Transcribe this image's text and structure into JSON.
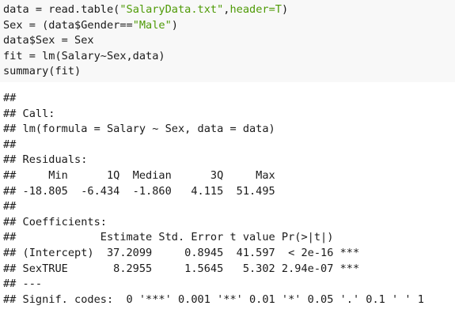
{
  "code": {
    "l1": {
      "a": "data = read.table(",
      "b": "\"SalaryData.txt\"",
      "c": ",",
      "d": "header=T",
      "e": ")"
    },
    "l2": {
      "a": "Sex = (data$Gender==",
      "b": "\"Male\"",
      "c": ")"
    },
    "l3": "data$Sex = Sex",
    "l4": "fit = lm(Salary~Sex,data)",
    "l5": "summary(fit)"
  },
  "output": [
    "##",
    "## Call:",
    "## lm(formula = Salary ~ Sex, data = data)",
    "##",
    "## Residuals:",
    "##     Min      1Q  Median      3Q     Max",
    "## -18.805  -6.434  -1.860   4.115  51.495",
    "##",
    "## Coefficients:",
    "##             Estimate Std. Error t value Pr(>|t|)",
    "## (Intercept)  37.2099     0.8945  41.597  < 2e-16 ***",
    "## SexTRUE       8.2955     1.5645   5.302 2.94e-07 ***",
    "## ---",
    "## Signif. codes:  0 '***' 0.001 '**' 0.01 '*' 0.05 '.' 0.1 ' ' 1"
  ]
}
